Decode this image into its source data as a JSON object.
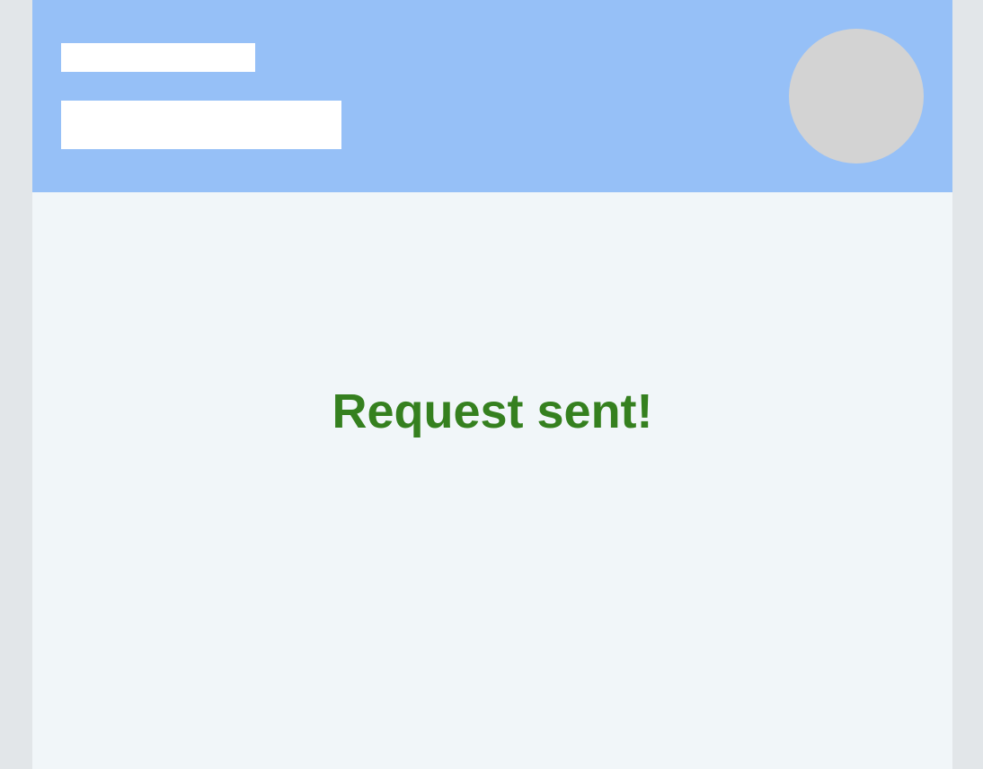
{
  "colors": {
    "outer_background": "#e2e6e9",
    "app_background": "#f1f6f9",
    "header_background": "#96c0f7",
    "placeholder": "#ffffff",
    "avatar": "#d3d3d3",
    "success_text": "#35801f"
  },
  "header": {
    "avatar_icon": "avatar-placeholder-circle"
  },
  "status": {
    "message": "Request sent!"
  }
}
